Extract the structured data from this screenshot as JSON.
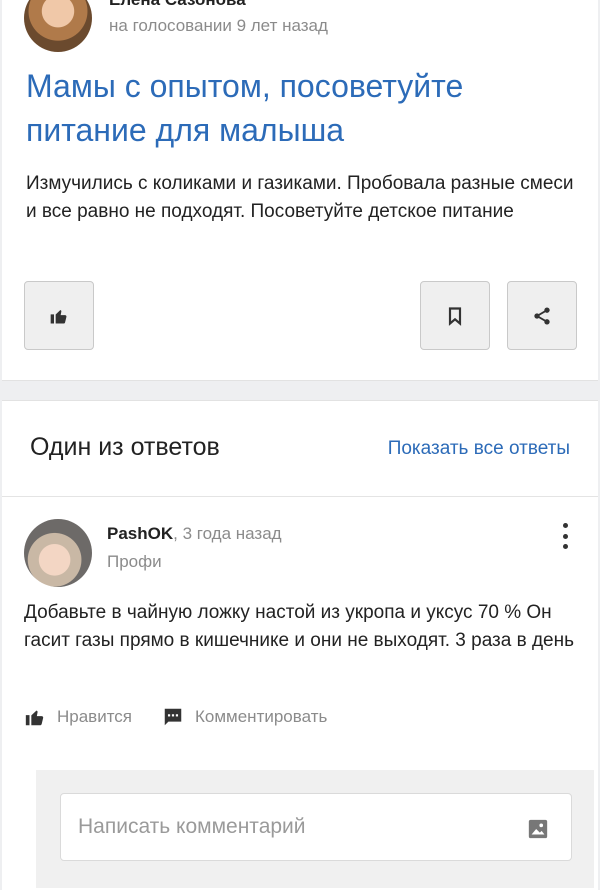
{
  "question": {
    "author": "Елена Сазонова",
    "meta": "на голосовании 9 лет назад",
    "title": "Мамы с опытом, посоветуйте питание для малыша",
    "body": "Измучились с коликами и газиками. Пробовала разные смеси и все равно не подходят. Посоветуйте детское питание"
  },
  "answers_section": {
    "title": "Один из ответов",
    "show_all": "Показать все ответы"
  },
  "answer": {
    "author": "PashOK",
    "separator": ", ",
    "time": "3 года назад",
    "role": "Профи",
    "body": "Добавьте в чайную ложку настой из укропа и уксус 70 % Он гасит газы прямо в кишечнике и они не выходят. 3 раза в день",
    "like_label": "Нравится",
    "comment_label": "Комментировать"
  },
  "comment": {
    "placeholder": "Написать комментарий"
  },
  "colors": {
    "link": "#2c6bb8",
    "muted": "#8b8b8b",
    "page_bg": "#eeeff1"
  },
  "icons": [
    "thumbs-up-icon",
    "bookmark-icon",
    "share-icon",
    "more-vertical-icon",
    "comment-icon",
    "image-icon"
  ]
}
